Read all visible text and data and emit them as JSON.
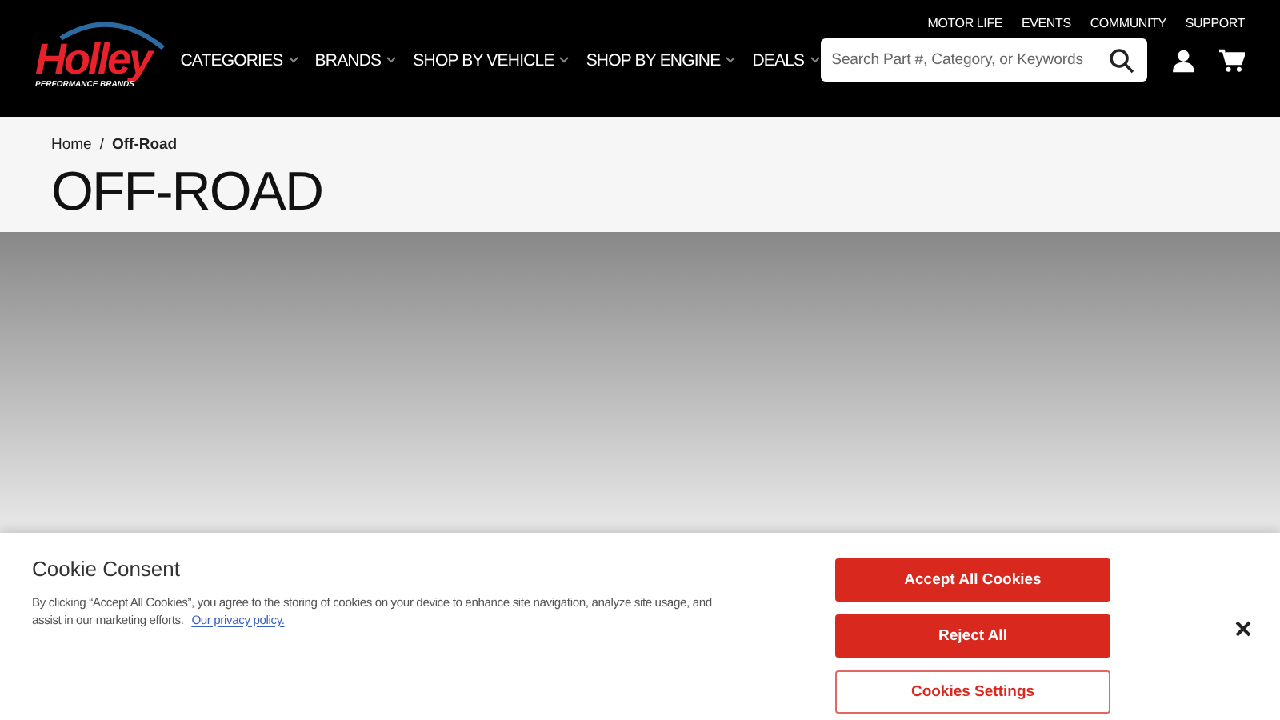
{
  "header": {
    "logo": {
      "name": "Holley",
      "tagline": "PERFORMANCE BRANDS"
    },
    "utility_links": [
      "MOTOR LIFE",
      "EVENTS",
      "COMMUNITY",
      "SUPPORT"
    ],
    "nav": [
      {
        "label": "CATEGORIES"
      },
      {
        "label": "BRANDS"
      },
      {
        "label": "SHOP BY VEHICLE"
      },
      {
        "label": "SHOP BY ENGINE"
      },
      {
        "label": "DEALS"
      }
    ],
    "search": {
      "placeholder": "Search Part #, Category, or Keywords"
    }
  },
  "breadcrumb_separator": "/",
  "breadcrumb": [
    {
      "label": "Home",
      "current": false
    },
    {
      "label": "Off-Road",
      "current": true
    }
  ],
  "page_title": "OFF-ROAD",
  "cookie_consent": {
    "title": "Cookie Consent",
    "text": "By clicking “Accept All Cookies”, you agree to the storing of cookies on your device to enhance site navigation, analyze site usage, and assist in our marketing efforts.",
    "link": "Our privacy policy.",
    "buttons": [
      {
        "label": "Accept All Cookies",
        "kind": "primary"
      },
      {
        "label": "Reject All",
        "kind": "primary"
      },
      {
        "label": "Cookies Settings",
        "kind": "outline"
      }
    ]
  }
}
